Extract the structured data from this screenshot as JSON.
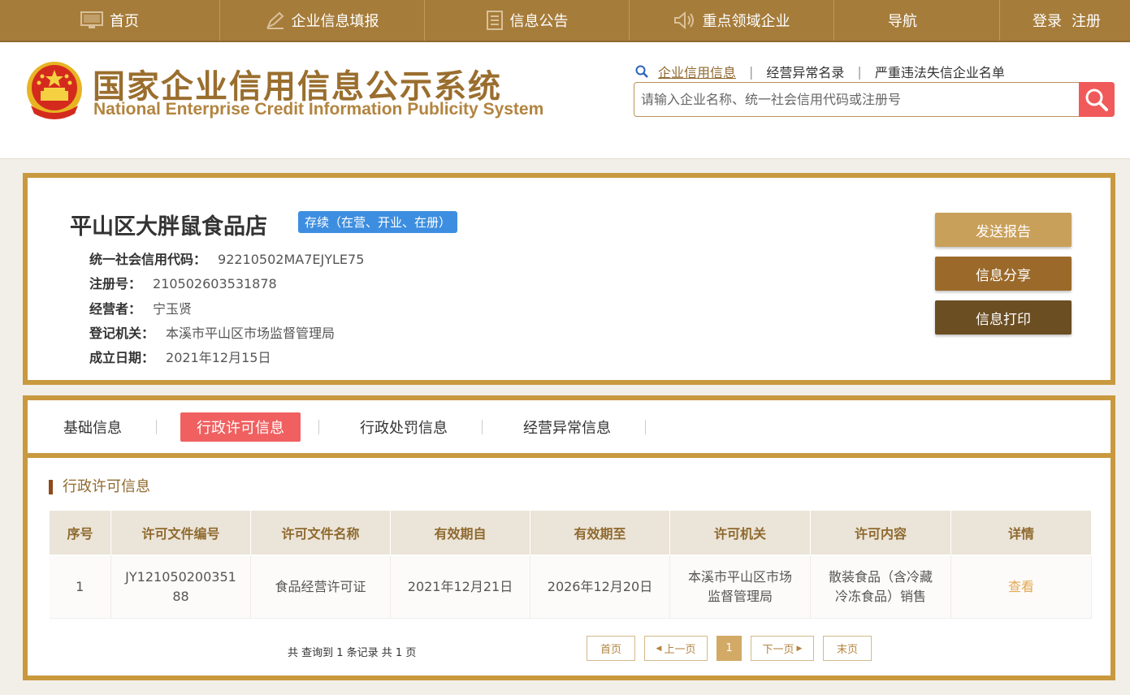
{
  "topnav": {
    "items": [
      {
        "label": "首页",
        "icon": "monitor-icon"
      },
      {
        "label": "企业信息填报",
        "icon": "pen-icon"
      },
      {
        "label": "信息公告",
        "icon": "document-icon"
      },
      {
        "label": "重点领域企业",
        "icon": "speaker-icon"
      },
      {
        "label": "导航",
        "icon": ""
      }
    ],
    "login": "登录",
    "register": "注册"
  },
  "header": {
    "title_cn": "国家企业信用信息公示系统",
    "title_en": "National Enterprise Credit Information Publicity System",
    "search_links": [
      "企业信用信息",
      "经营异常名录",
      "严重违法失信企业名单"
    ],
    "search_placeholder": "请输入企业名称、统一社会信用代码或注册号"
  },
  "company": {
    "name": "平山区大胖鼠食品店",
    "status": "存续（在营、开业、在册）",
    "fields": [
      {
        "label": "统一社会信用代码：",
        "value": "92210502MA7EJYLE75"
      },
      {
        "label": "注册号：",
        "value": "210502603531878"
      },
      {
        "label": "经营者：",
        "value": "宁玉贤"
      },
      {
        "label": "登记机关：",
        "value": "本溪市平山区市场监督管理局"
      },
      {
        "label": "成立日期：",
        "value": "2021年12月15日"
      }
    ],
    "buttons": [
      "发送报告",
      "信息分享",
      "信息打印"
    ]
  },
  "tabs": [
    "基础信息",
    "行政许可信息",
    "行政处罚信息",
    "经营异常信息"
  ],
  "section_title": "行政许可信息",
  "table": {
    "headers": [
      "序号",
      "许可文件编号",
      "许可文件名称",
      "有效期自",
      "有效期至",
      "许可机关",
      "许可内容",
      "详情"
    ],
    "rows": [
      [
        "1",
        "JY121050200351 88",
        "食品经营许可证",
        "2021年12月21日",
        "2026年12月20日",
        "本溪市平山区市场 监督管理局",
        "散装食品（含冷藏 冷冻食品）销售",
        "查看"
      ]
    ]
  },
  "pager": {
    "summary": "共 查询到 1 条记录 共 1 页",
    "first": "首页",
    "prev": "上一页",
    "current": "1",
    "next": "下一页",
    "last": "末页"
  },
  "colors": {
    "gold": "#c9993f",
    "nav": "#a67c3a",
    "accent_red": "#f06060",
    "status_blue": "#3d8ee0"
  }
}
